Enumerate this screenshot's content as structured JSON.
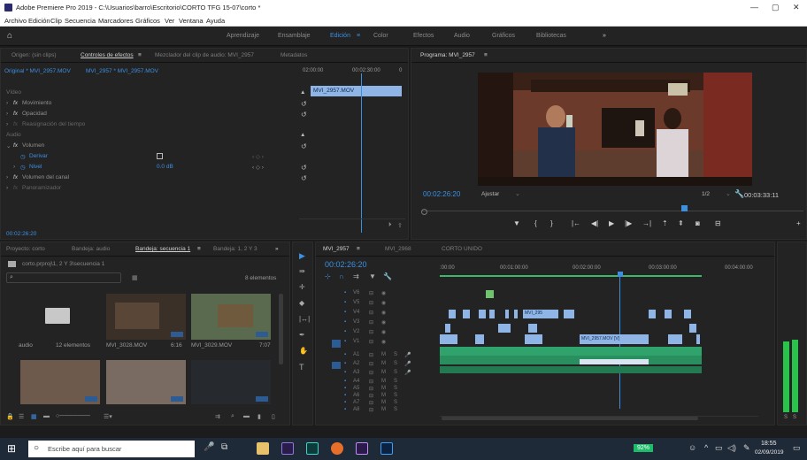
{
  "window": {
    "title": "Adobe Premiere Pro 2019 - C:\\Usuarios\\barro\\Escritorio\\CORTO TFG 15-07\\corto *",
    "minimize": "—",
    "maximize": "▢",
    "close": "✕"
  },
  "menu": [
    "Archivo",
    "Edición",
    "Clip",
    "Secuencia",
    "Marcadores",
    "Gráficos",
    "Ver",
    "Ventana",
    "Ayuda"
  ],
  "workspaces": {
    "items": [
      "Aprendizaje",
      "Ensamblaje",
      "Edición",
      "Color",
      "Efectos",
      "Audio",
      "Gráficos",
      "Bibliotecas"
    ],
    "active": "Edición",
    "more": "»",
    "menu": "≡"
  },
  "effects": {
    "tabs": [
      "Origen: (sin clips)",
      "Controles de efectos",
      "Mezclador del clip de audio: MVI_2957",
      "Metadatos"
    ],
    "menu": "≡",
    "clip_path": "Original * MVI_2957.MOV",
    "clip_seq": "MVI_2957 * MVI_2957.MOV",
    "time_ruler": [
      "02:00:00",
      "00:02:30:00",
      "0"
    ],
    "clip_label": "MVI_2957.MOV",
    "rows": {
      "video": "Vídeo",
      "movimiento": "Movimiento",
      "opacidad": "Opacidad",
      "reasignacion": "Reasignación del tiempo",
      "audio": "Audio",
      "volumen": "Volumen",
      "derivar": "Derivar",
      "nivel": "Nivel",
      "nivel_value": "0.0 dB",
      "volumen_canal": "Volumen del canal",
      "panoramizador": "Panoramizador"
    },
    "timecode": "00:02:26:20"
  },
  "program": {
    "title": "Programa: MVI_2957",
    "menu": "≡",
    "timecode": "00:02:26:20",
    "fit": "Ajustar",
    "fraction": "1/2",
    "duration": "00:03:33:11"
  },
  "project": {
    "tabs": [
      "Proyecto: corto",
      "Bandeja: audio",
      "Bandeja: secuencia 1",
      "Bandeja: 1, 2 Y 3"
    ],
    "more": "»",
    "menu": "≡",
    "path": "corto.prproj\\1, 2 Y 3\\secuencia 1",
    "count": "8 elementos",
    "items": [
      {
        "name": "audio",
        "meta": "12 elementos"
      },
      {
        "name": "MVI_3028.MOV",
        "meta": "6:16"
      },
      {
        "name": "MVI_3029.MOV",
        "meta": "7:07"
      }
    ]
  },
  "timeline": {
    "tabs": [
      "MVI_2957",
      "MVI_2968",
      "CORTO UNIDO"
    ],
    "menu": "≡",
    "timecode": "00:02:26:20",
    "ruler": [
      ":00:00",
      "00:01:00:00",
      "00:02:00:00",
      "00:03:00:00",
      "00:04:00:00"
    ],
    "video_tracks": [
      "V6",
      "V5",
      "V4",
      "V3",
      "V2",
      "V1"
    ],
    "audio_tracks": [
      "A1",
      "A2",
      "A3",
      "A4",
      "A5",
      "A6",
      "A7",
      "A8"
    ],
    "clip_labels": [
      "MVI_295",
      "MVI_2957.MOV [V]"
    ]
  },
  "meters": {
    "labels": [
      "S",
      "S"
    ]
  },
  "taskbar": {
    "search_placeholder": "Escribe aquí para buscar",
    "battery": "92%",
    "time": "18:55",
    "date": "02/09/2019"
  },
  "colors": {
    "accent": "#3d8fe0",
    "clip_video": "#8fb4e6",
    "clip_audio": "#2fa36b",
    "playhead": "#3d8fe0"
  }
}
